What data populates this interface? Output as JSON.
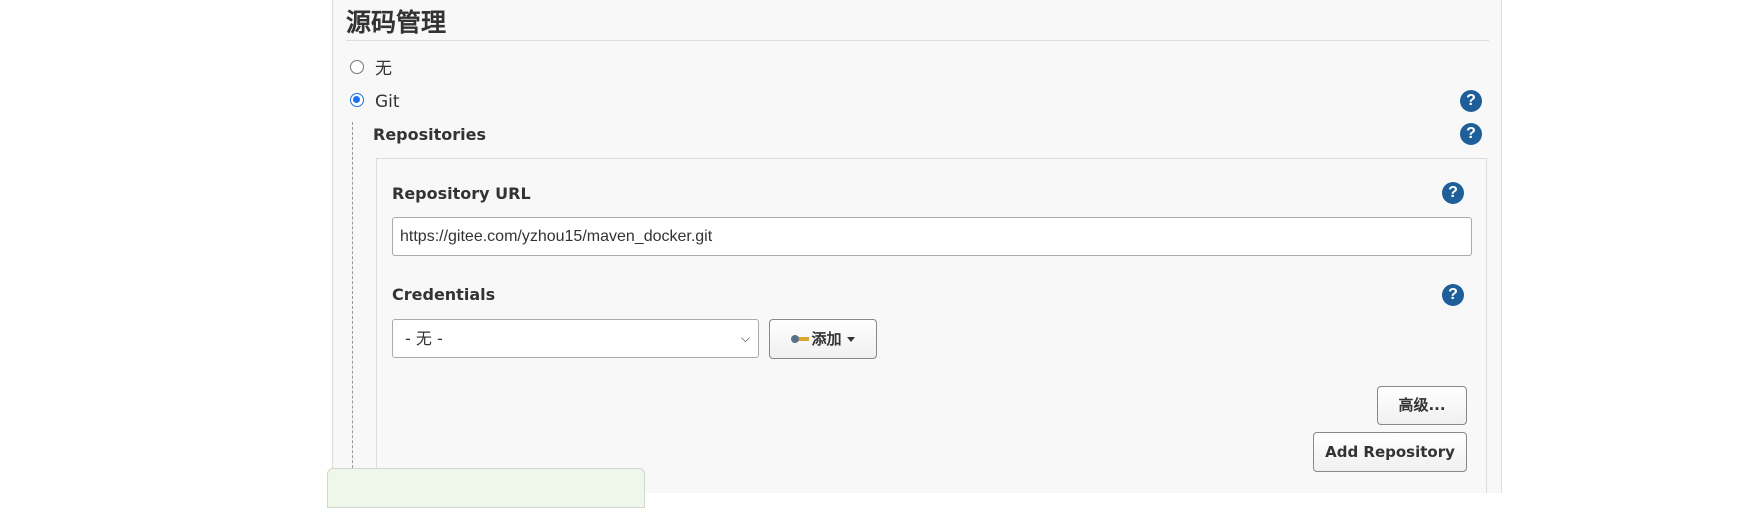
{
  "section": {
    "title": "源码管理"
  },
  "scm_options": [
    {
      "label": "无",
      "checked": false
    },
    {
      "label": "Git",
      "checked": true
    }
  ],
  "repositories": {
    "label": "Repositories",
    "repository_url": {
      "label": "Repository URL",
      "value": "https://gitee.com/yzhou15/maven_docker.git"
    },
    "credentials": {
      "label": "Credentials",
      "selected": "- 无 -",
      "add_button": "添加"
    },
    "advanced_button": "高级...",
    "add_repository_button": "Add Repository"
  },
  "help_icon_glyph": "?",
  "colors": {
    "help_icon": "#1f5f99",
    "radio_checked": "#1a73e8",
    "panel_bg": "#f8f8f8"
  }
}
